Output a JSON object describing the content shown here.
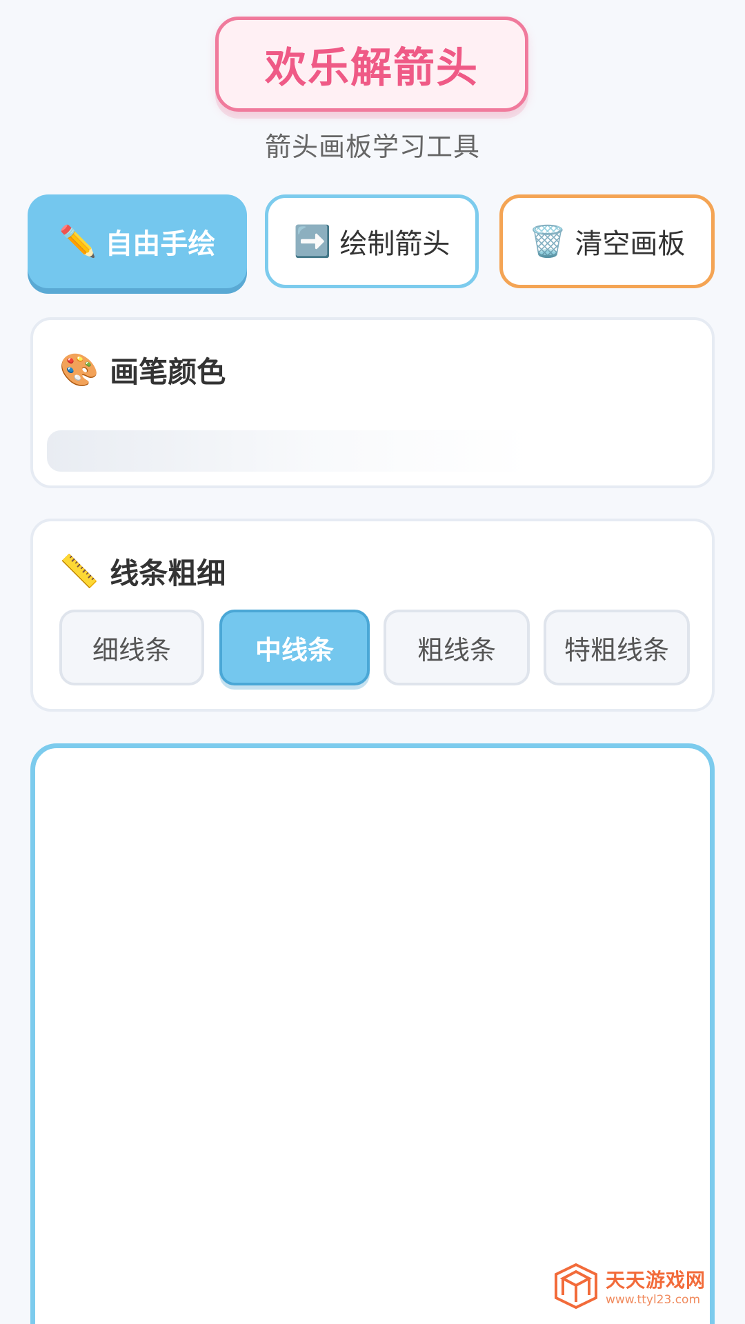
{
  "header": {
    "title": "欢乐解箭头",
    "subtitle": "箭头画板学习工具"
  },
  "toolbar": {
    "free_draw": {
      "icon": "✏️",
      "label": "自由手绘",
      "active": true
    },
    "draw_arrow": {
      "icon": "➡️",
      "label": "绘制箭头"
    },
    "clear_board": {
      "icon": "🗑️",
      "label": "清空画板"
    }
  },
  "color_panel": {
    "icon": "🎨",
    "title": "画笔颜色"
  },
  "width_panel": {
    "icon": "📏",
    "title": "线条粗细",
    "options": [
      {
        "label": "细线条"
      },
      {
        "label": "中线条",
        "selected": true
      },
      {
        "label": "粗线条"
      },
      {
        "label": "特粗线条"
      }
    ]
  },
  "watermark": {
    "name": "天天游戏网",
    "url": "www.ttyl23.com"
  },
  "colors": {
    "accent_blue": "#74c7ee",
    "accent_pink": "#ef5a86",
    "accent_orange": "#f4a454"
  }
}
